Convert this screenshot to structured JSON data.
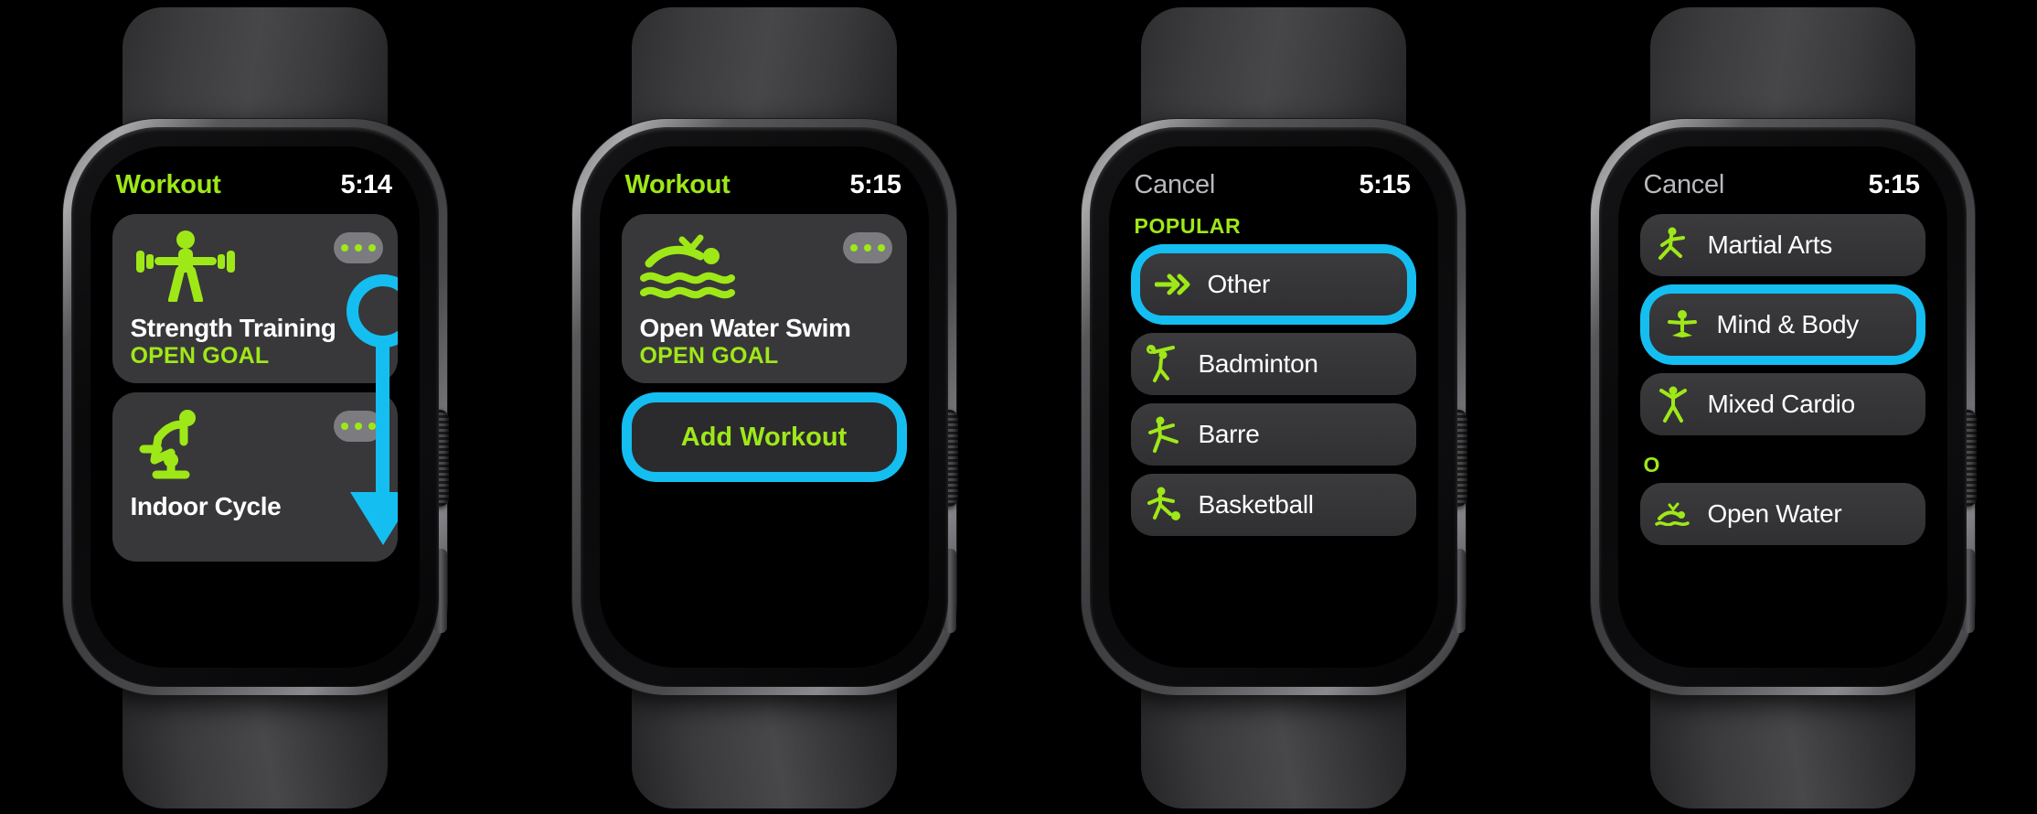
{
  "colors": {
    "accent_green": "#9FE818",
    "highlight_blue": "#15BEF0",
    "card_grey": "#38383A",
    "screen_black": "#000000"
  },
  "watches": [
    {
      "id": "watch-1",
      "status": {
        "title": "Workout",
        "title_style": "green",
        "time": "5:14"
      },
      "screen_type": "workout-cards",
      "cards": [
        {
          "icon": "strength-training-icon",
          "name": "Strength Training",
          "goal": "OPEN GOAL",
          "more": "more-options-icon"
        },
        {
          "icon": "indoor-cycle-icon",
          "name": "Indoor Cycle",
          "goal": "",
          "more": "more-options-icon"
        }
      ],
      "annotation": {
        "type": "scroll-down-arrow",
        "shape": "circle-with-down-arrow"
      }
    },
    {
      "id": "watch-2",
      "status": {
        "title": "Workout",
        "title_style": "green",
        "time": "5:15"
      },
      "screen_type": "workout-cards-with-add",
      "cards": [
        {
          "icon": "open-water-swim-icon",
          "name": "Open Water Swim",
          "goal": "OPEN GOAL",
          "more": "more-options-icon"
        }
      ],
      "add_button": {
        "label": "Add Workout",
        "highlighted": true
      }
    },
    {
      "id": "watch-3",
      "status": {
        "title": "Cancel",
        "title_style": "grey",
        "time": "5:15"
      },
      "screen_type": "workout-list",
      "section_header": "POPULAR",
      "rows": [
        {
          "icon": "other-chevrons-icon",
          "label": "Other",
          "highlighted": true
        },
        {
          "icon": "badminton-icon",
          "label": "Badminton",
          "highlighted": false
        },
        {
          "icon": "barre-icon",
          "label": "Barre",
          "highlighted": false
        },
        {
          "icon": "basketball-icon",
          "label": "Basketball",
          "highlighted": false
        }
      ]
    },
    {
      "id": "watch-4",
      "status": {
        "title": "Cancel",
        "title_style": "grey",
        "time": "5:15"
      },
      "screen_type": "workout-list",
      "section_header": "",
      "rows": [
        {
          "icon": "martial-arts-icon",
          "label": "Martial Arts",
          "highlighted": false
        },
        {
          "icon": "mind-and-body-icon",
          "label": "Mind & Body",
          "highlighted": true
        },
        {
          "icon": "mixed-cardio-icon",
          "label": "Mixed Cardio",
          "highlighted": false
        }
      ],
      "section_header_2": "O",
      "rows_2": [
        {
          "icon": "open-water-swim-small-icon",
          "label": "Open Water",
          "highlighted": false
        }
      ]
    }
  ]
}
